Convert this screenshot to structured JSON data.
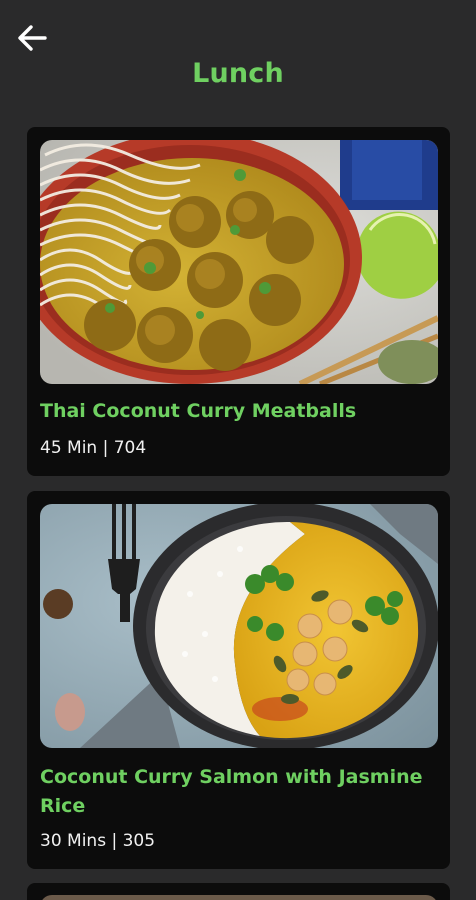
{
  "header": {
    "back_icon": "arrow-left-icon",
    "title": "Lunch"
  },
  "colors": {
    "background": "#2a2a2b",
    "card": "#0c0c0c",
    "accent": "#6fd061",
    "text": "#f1f1f1"
  },
  "recipes": [
    {
      "title": "Thai Coconut Curry Meatballs",
      "meta": "45 Min | 704"
    },
    {
      "title": "Coconut Curry Salmon with Jasmine Rice",
      "meta": "30 Mins | 305"
    }
  ]
}
